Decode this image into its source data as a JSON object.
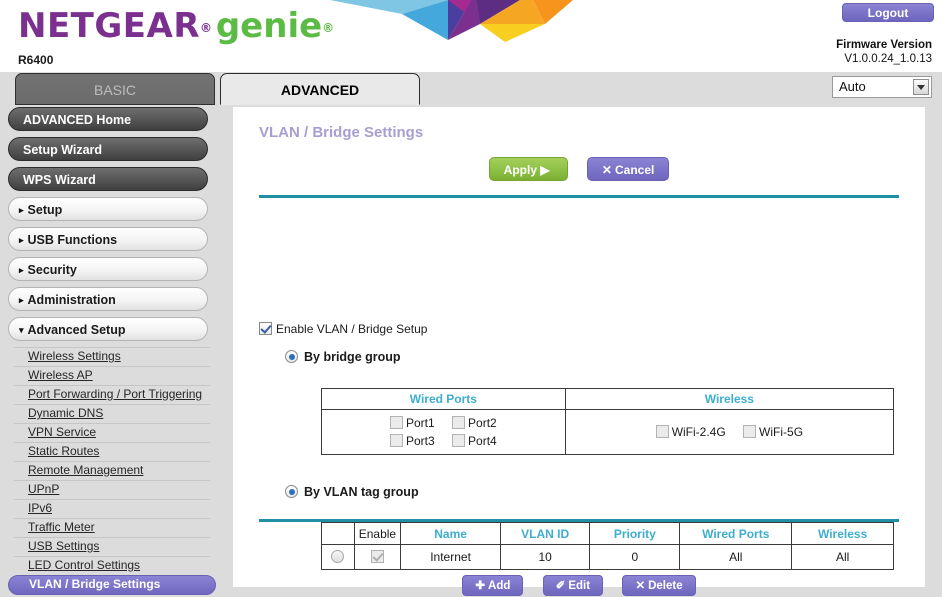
{
  "header": {
    "brand_netgear": "NETGEAR",
    "brand_genie": "genie",
    "registered_mark": "®",
    "model": "R6400",
    "logout_label": "Logout",
    "firmware_label": "Firmware Version",
    "firmware_value": "V1.0.0.24_1.0.13",
    "language_selected": "Auto",
    "colors": {
      "netgear_purple": "#7b2f8e",
      "genie_green": "#5cbb45",
      "accent_purple": "#7b73c8",
      "accent_teal": "#1f8fa3",
      "apply_green": "#8dc045",
      "table_header_cyan": "#3eaecd",
      "title_lavender": "#a99ed1"
    }
  },
  "tabs": [
    {
      "label": "BASIC",
      "active": false
    },
    {
      "label": "ADVANCED",
      "active": true
    }
  ],
  "sidebar": {
    "buttons": [
      {
        "label": "ADVANCED Home",
        "style": "dark"
      },
      {
        "label": "Setup Wizard",
        "style": "dark"
      },
      {
        "label": "WPS Wizard",
        "style": "dark"
      }
    ],
    "sections": [
      {
        "label": "Setup",
        "caret": "▸",
        "expanded": false
      },
      {
        "label": "USB Functions",
        "caret": "▸",
        "expanded": false
      },
      {
        "label": "Security",
        "caret": "▸",
        "expanded": false
      },
      {
        "label": "Administration",
        "caret": "▸",
        "expanded": false
      },
      {
        "label": "Advanced Setup",
        "caret": "▾",
        "expanded": true
      }
    ],
    "submenu": [
      {
        "label": "Wireless Settings",
        "active": false
      },
      {
        "label": "Wireless AP",
        "active": false
      },
      {
        "label": "Port Forwarding / Port Triggering",
        "active": false
      },
      {
        "label": "Dynamic DNS",
        "active": false
      },
      {
        "label": "VPN Service",
        "active": false
      },
      {
        "label": "Static Routes",
        "active": false
      },
      {
        "label": "Remote Management",
        "active": false
      },
      {
        "label": "UPnP",
        "active": false
      },
      {
        "label": "IPv6",
        "active": false
      },
      {
        "label": "Traffic Meter",
        "active": false
      },
      {
        "label": "USB Settings",
        "active": false
      },
      {
        "label": "LED Control Settings",
        "active": false
      },
      {
        "label": "VLAN / Bridge Settings",
        "active": true
      }
    ]
  },
  "main": {
    "title": "VLAN / Bridge Settings",
    "apply_label": "Apply",
    "apply_glyph": "▶",
    "cancel_label": "Cancel",
    "cancel_glyph": "✕",
    "enable_checkbox_label": "Enable VLAN / Bridge Setup",
    "enable_checked": true,
    "option_bridge_label": "By bridge group",
    "option_vlan_label": "By VLAN tag group",
    "bridge_table": {
      "headers": [
        "Wired Ports",
        "Wireless"
      ],
      "wired_ports": [
        {
          "label": "Port1",
          "checked": false
        },
        {
          "label": "Port2",
          "checked": false
        },
        {
          "label": "Port3",
          "checked": false
        },
        {
          "label": "Port4",
          "checked": false
        }
      ],
      "wireless": [
        {
          "label": "WiFi-2.4G",
          "checked": false
        },
        {
          "label": "WiFi-5G",
          "checked": false
        }
      ]
    },
    "vlan_table": {
      "headers": [
        "",
        "Enable",
        "Name",
        "VLAN ID",
        "Priority",
        "Wired Ports",
        "Wireless"
      ],
      "rows": [
        {
          "selected": false,
          "enable": true,
          "name": "Internet",
          "vlan_id": "10",
          "priority": "0",
          "wired_ports": "All",
          "wireless": "All"
        }
      ]
    },
    "row_buttons": [
      {
        "label": "Add",
        "glyph": "✚"
      },
      {
        "label": "Edit",
        "glyph": "✐"
      },
      {
        "label": "Delete",
        "glyph": "✕"
      }
    ]
  }
}
